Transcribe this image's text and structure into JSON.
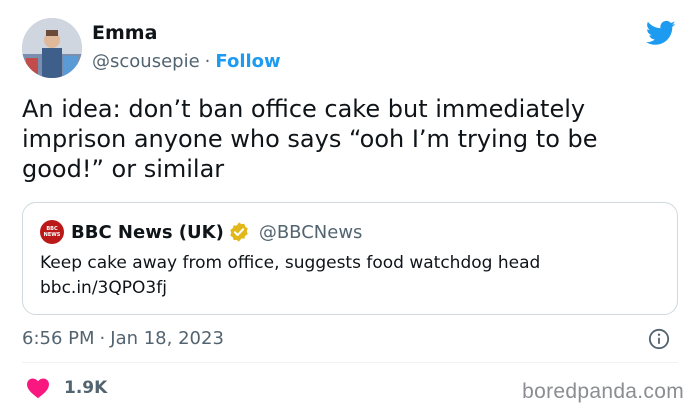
{
  "author": {
    "name": "Emma",
    "handle": "@scousepie",
    "separator": "·",
    "follow_label": "Follow"
  },
  "icons": {
    "avatar": "avatar-photo",
    "platform": "twitter-bird-icon",
    "verified": "verified-badge-icon",
    "info": "info-icon",
    "like": "heart-icon"
  },
  "tweet": {
    "text": "An idea: don’t ban office cake but immediately imprison anyone who says “ooh I’m trying to be good!” or similar"
  },
  "quoted": {
    "logo_text_top": "BBC",
    "logo_text_bottom": "NEWS",
    "name": "BBC News (UK)",
    "handle": "@BBCNews",
    "text_line1": "Keep cake away from office, suggests food watchdog head",
    "text_line2": "bbc.in/3QPO3fj"
  },
  "meta": {
    "time": "6:56 PM",
    "separator": "·",
    "date": "Jan 18, 2023"
  },
  "engagement": {
    "likes": "1.9K"
  },
  "watermark": "boredpanda.com",
  "colors": {
    "accent": "#1d9bf0",
    "heart": "#f91880",
    "bbc_red": "#bb1919",
    "verified_gold": "#e2b719",
    "secondary_text": "#536471"
  }
}
